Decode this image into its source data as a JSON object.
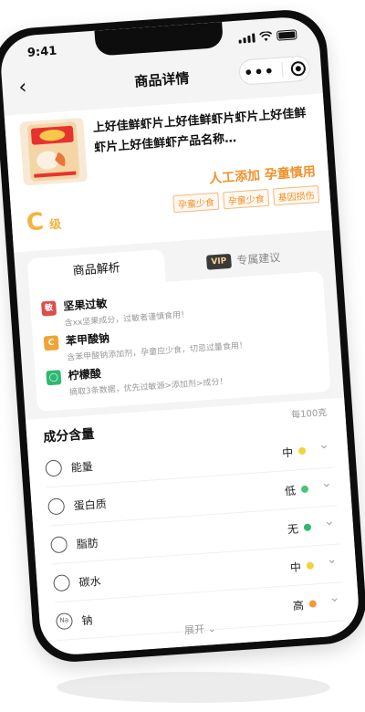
{
  "status": {
    "time": "9:41"
  },
  "nav": {
    "back": "‹",
    "title": "商品详情",
    "more": "•••"
  },
  "product": {
    "name": "上好佳鲜虾片上好佳鲜虾片虾片上好佳鲜虾片上好佳鲜虾产品名称…",
    "warning": "人工添加 孕童慎用",
    "tags": [
      "孕童少食",
      "孕童少食",
      "基因损伤"
    ],
    "grade": "C",
    "grade_suffix": "级"
  },
  "tabs": {
    "active": "商品解析",
    "vip_badge": "VIP",
    "vip": "专属建议"
  },
  "analysis": [
    {
      "icon": "敏",
      "color": "#e04b4b",
      "name": "坚果过敏",
      "desc": "含xx坚果成分，过敏者谨慎食用！"
    },
    {
      "icon": "C",
      "color": "#f3a236",
      "name": "苯甲酸钠",
      "desc": "含苯甲酸钠添加剂，孕童应少食，切忌过量食用！"
    },
    {
      "icon": "◯",
      "color": "#2fb872",
      "name": "柠檬酸",
      "desc": "摘取3条数据，优先过敏源>添加剂>成分！"
    }
  ],
  "nutrition": {
    "title": "成分含量",
    "unit": "每100克",
    "rows": [
      {
        "label": "能量",
        "level": "中",
        "color": "#f3d23a",
        "icon": "energy-icon"
      },
      {
        "label": "蛋白质",
        "level": "低",
        "color": "#49c672",
        "icon": "protein-icon"
      },
      {
        "label": "脂肪",
        "level": "无",
        "color": "#2fb872",
        "icon": "fat-icon"
      },
      {
        "label": "碳水",
        "level": "中",
        "color": "#f3d23a",
        "icon": "carb-icon"
      },
      {
        "label": "钠",
        "level": "高",
        "color": "#f39a36",
        "icon": "sodium-icon",
        "icon_text": "Na"
      }
    ],
    "expand": "展开 ⌄"
  },
  "colors": {
    "accent": "#f0922e",
    "grade": "#f5b33f"
  }
}
